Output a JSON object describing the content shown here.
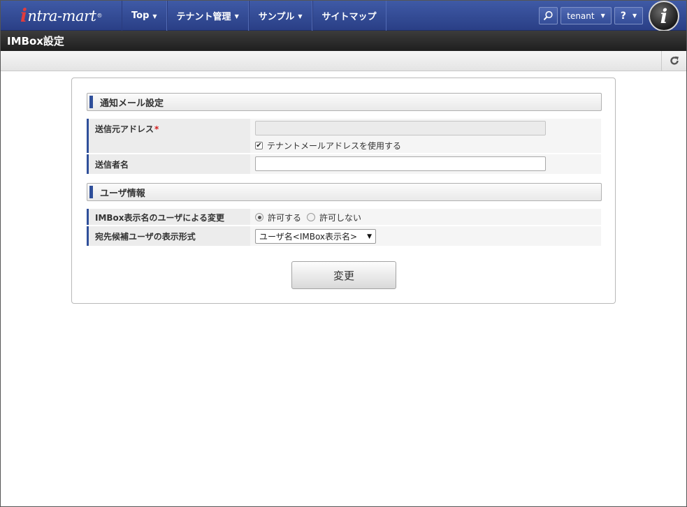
{
  "header": {
    "logo_main": "ntra-mart",
    "logo_prefix": "i",
    "logo_reg": "®",
    "nav": [
      {
        "label": "Top",
        "has_dropdown": true
      },
      {
        "label": "テナント管理",
        "has_dropdown": true
      },
      {
        "label": "サンプル",
        "has_dropdown": true
      },
      {
        "label": "サイトマップ",
        "has_dropdown": false
      }
    ],
    "tenant_label": "tenant",
    "help_label": "?",
    "brand_mark": "i"
  },
  "page": {
    "title": "IMBox設定"
  },
  "sections": {
    "mail": {
      "title": "通知メール設定",
      "sender_address_label": "送信元アドレス",
      "required_mark": "*",
      "sender_address_value": "",
      "use_tenant_address_label": "テナントメールアドレスを使用する",
      "use_tenant_address_checked": true,
      "sender_name_label": "送信者名",
      "sender_name_value": ""
    },
    "user": {
      "title": "ユーザ情報",
      "change_display_name_label": "IMBox表示名のユーザによる変更",
      "allow_label": "許可する",
      "deny_label": "許可しない",
      "selected": "allow",
      "display_format_label": "宛先候補ユーザの表示形式",
      "display_format_value": "ユーザ名<IMBox表示名>"
    }
  },
  "actions": {
    "submit_label": "変更"
  },
  "colors": {
    "nav_bg": "#2f4a97",
    "title_bar_bg": "#2a2a2a",
    "accent_bar": "#2f4f9a",
    "required": "#d21c1c"
  }
}
